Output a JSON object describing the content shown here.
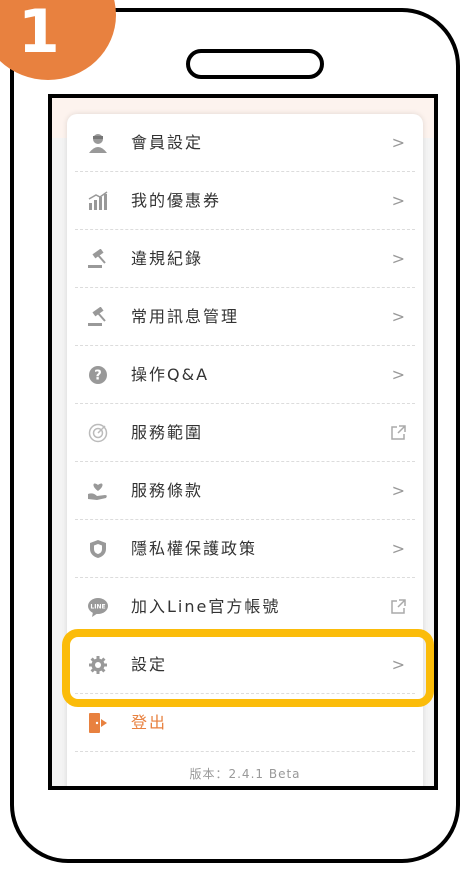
{
  "step_badge": "1",
  "menu": {
    "items": [
      {
        "label": "會員設定",
        "icon": "member-icon",
        "action": "chevron"
      },
      {
        "label": "我的優惠券",
        "icon": "coupon-chart-icon",
        "action": "chevron"
      },
      {
        "label": "違規紀錄",
        "icon": "gavel-icon",
        "action": "chevron"
      },
      {
        "label": "常用訊息管理",
        "icon": "gavel-icon",
        "action": "chevron"
      },
      {
        "label": "操作Q&A",
        "icon": "help-icon",
        "action": "chevron"
      },
      {
        "label": "服務範圍",
        "icon": "target-icon",
        "action": "external"
      },
      {
        "label": "服務條款",
        "icon": "heart-hand-icon",
        "action": "chevron"
      },
      {
        "label": "隱私權保護政策",
        "icon": "shield-icon",
        "action": "chevron"
      },
      {
        "label": "加入Line官方帳號",
        "icon": "line-icon",
        "action": "external"
      },
      {
        "label": "設定",
        "icon": "gear-icon",
        "action": "chevron"
      }
    ],
    "logout": {
      "label": "登出",
      "icon": "logout-icon"
    },
    "chevron": ">",
    "version": "版本：2.4.1 Beta"
  },
  "colors": {
    "accent": "#e8813f",
    "highlight": "#fbbc0a",
    "icon_gray": "#999999"
  }
}
